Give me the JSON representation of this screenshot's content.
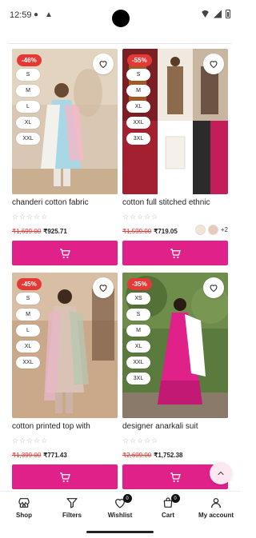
{
  "status_bar": {
    "time": "12:59"
  },
  "products": [
    {
      "discount": "-46%",
      "sizes": [
        "S",
        "M",
        "L",
        "XL",
        "XXL"
      ],
      "title": "chanderi cotton fabric",
      "old_price": "₹1,699.00",
      "new_price": "₹925.71",
      "rating_stars": "☆☆☆☆☆"
    },
    {
      "discount": "-55%",
      "sizes": [
        "S",
        "M",
        "XL",
        "XXL",
        "3XL"
      ],
      "title": "cotton full stitched ethnic",
      "old_price": "₹1,599.00",
      "new_price": "₹719.05",
      "rating_stars": "☆☆☆☆☆",
      "more_colors": "+2"
    },
    {
      "discount": "-45%",
      "sizes": [
        "S",
        "M",
        "L",
        "XL",
        "XXL"
      ],
      "title": "cotton printed top with",
      "old_price": "₹1,399.00",
      "new_price": "₹771.43",
      "rating_stars": "☆☆☆☆☆"
    },
    {
      "discount": "-35%",
      "sizes": [
        "XS",
        "S",
        "M",
        "XL",
        "XXL",
        "3XL"
      ],
      "title": "designer anarkali suit",
      "old_price": "₹2,699.00",
      "new_price": "₹1,752.38",
      "rating_stars": "☆☆☆☆☆"
    }
  ],
  "nav": {
    "shop": "Shop",
    "filters": "Filters",
    "wishlist": "Wishlist",
    "wishlist_count": "0",
    "cart": "Cart",
    "cart_count": "0",
    "account": "My account"
  },
  "colors": {
    "accent": "#e0218a",
    "discount": "#e53935"
  }
}
